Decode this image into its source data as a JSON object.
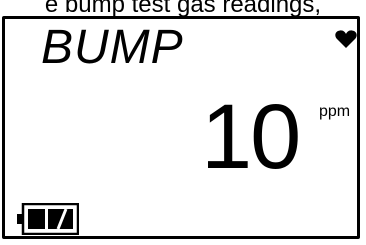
{
  "caption": "e bump test gas readings,",
  "display": {
    "mode": "BUMP",
    "reading": "10",
    "unit": "ppm"
  },
  "icons": {
    "status": "heart-icon",
    "battery": "battery-icon"
  },
  "colors": {
    "foreground": "#000000",
    "background": "#ffffff"
  }
}
